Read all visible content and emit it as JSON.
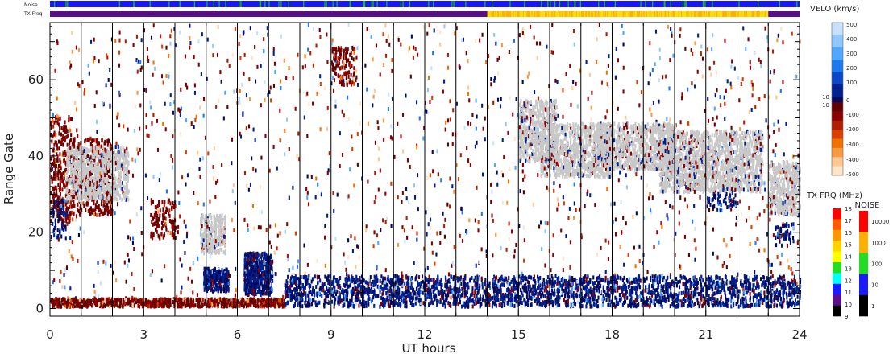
{
  "chart_data": {
    "type": "heatmap",
    "title": "",
    "xlabel": "UT hours",
    "ylabel": "Range Gate",
    "xlim": [
      0,
      24
    ],
    "ylim": [
      -2,
      75
    ],
    "x_ticks": [
      "0",
      "3",
      "6",
      "9",
      "12",
      "15",
      "18",
      "21",
      "24"
    ],
    "y_ticks": [
      "0",
      "20",
      "40",
      "60"
    ],
    "scan_boundaries_hours": [
      1,
      2,
      3,
      4,
      5,
      6,
      7,
      8,
      9,
      10,
      11,
      12,
      13,
      14,
      15,
      16,
      17,
      18,
      19,
      20,
      21,
      22,
      23
    ],
    "top_strips": [
      {
        "label": "Noise",
        "segments": [
          {
            "from": 0,
            "to": 24,
            "color": "#1a1aee",
            "accent": "#22bb22"
          }
        ]
      },
      {
        "label": "TX Freq",
        "segments": [
          {
            "from": 0,
            "to": 14,
            "color": "#5a0f8a"
          },
          {
            "from": 14,
            "to": 23,
            "color": "#ffb000",
            "accent": "#ffe000"
          },
          {
            "from": 23,
            "to": 24,
            "color": "#5a0f8a"
          }
        ]
      }
    ],
    "echo_regions": [
      {
        "x": [
          0,
          0.7
        ],
        "gate": [
          22,
          50
        ],
        "kind": "neg"
      },
      {
        "x": [
          0,
          0.5
        ],
        "gate": [
          18,
          28
        ],
        "kind": "pos"
      },
      {
        "x": [
          0.7,
          2.0
        ],
        "gate": [
          24,
          44
        ],
        "kind": "neg"
      },
      {
        "x": [
          0.5,
          2.5
        ],
        "gate": [
          28,
          42
        ],
        "kind": "gray"
      },
      {
        "x": [
          3.2,
          4.0
        ],
        "gate": [
          18,
          28
        ],
        "kind": "neg"
      },
      {
        "x": [
          4.8,
          5.6
        ],
        "gate": [
          14,
          24
        ],
        "kind": "gray"
      },
      {
        "x": [
          4.9,
          5.7
        ],
        "gate": [
          4,
          10
        ],
        "kind": "pos_dense"
      },
      {
        "x": [
          6.2,
          7.1
        ],
        "gate": [
          3,
          14
        ],
        "kind": "pos_dense"
      },
      {
        "x": [
          9.0,
          9.8
        ],
        "gate": [
          58,
          68
        ],
        "kind": "neg"
      },
      {
        "x": [
          15.0,
          16.2
        ],
        "gate": [
          38,
          54
        ],
        "kind": "gray"
      },
      {
        "x": [
          15.7,
          18.0
        ],
        "gate": [
          34,
          48
        ],
        "kind": "gray"
      },
      {
        "x": [
          17.5,
          20.0
        ],
        "gate": [
          36,
          48
        ],
        "kind": "gray"
      },
      {
        "x": [
          19.5,
          22.8
        ],
        "gate": [
          30,
          46
        ],
        "kind": "gray"
      },
      {
        "x": [
          21.0,
          22.0
        ],
        "gate": [
          26,
          30
        ],
        "kind": "pos"
      },
      {
        "x": [
          23.0,
          24.0
        ],
        "gate": [
          24,
          38
        ],
        "kind": "gray"
      },
      {
        "x": [
          23.2,
          23.8
        ],
        "gate": [
          16,
          22
        ],
        "kind": "pos"
      },
      {
        "x": [
          0,
          7.5
        ],
        "gate": [
          0,
          2
        ],
        "kind": "neg_dense"
      },
      {
        "x": [
          7.5,
          24.0
        ],
        "gate": [
          0,
          8
        ],
        "kind": "pos_band"
      }
    ],
    "velocity_scale": {
      "title": "VELO (km/s)",
      "ticks": [
        "500",
        "400",
        "300",
        "200",
        "100",
        "10",
        "0",
        "-10",
        "-100",
        "-200",
        "-300",
        "-400",
        "-500"
      ],
      "colors_pos": [
        "#c8e0ff",
        "#8ec8ff",
        "#4ea8ff",
        "#1e78f0",
        "#0a48c8",
        "#002090",
        "#000a60"
      ],
      "colors_neg": [
        "#600000",
        "#8a0000",
        "#b02000",
        "#d84000",
        "#f07000",
        "#f89a40",
        "#ffc890",
        "#ffe4c8"
      ]
    },
    "tx_freq_scale": {
      "title": "TX FRQ (MHz)",
      "ticks": [
        "18",
        "17",
        "16",
        "15",
        "14",
        "13",
        "12",
        "11",
        "10",
        "9"
      ],
      "colors": [
        "#ff0000",
        "#ff5a00",
        "#ff9500",
        "#ffd200",
        "#ffff00",
        "#22dd22",
        "#00ffff",
        "#1a1aff",
        "#5a0f8a",
        "#000000"
      ]
    },
    "noise_scale": {
      "title": "NOISE",
      "ticks": [
        "10000",
        "1000",
        "100",
        "10",
        "1"
      ],
      "colors": [
        "#ff0000",
        "#ffb000",
        "#22dd22",
        "#1a1aff",
        "#000000"
      ]
    },
    "ground_scatter_color": "#c8c8c8"
  }
}
